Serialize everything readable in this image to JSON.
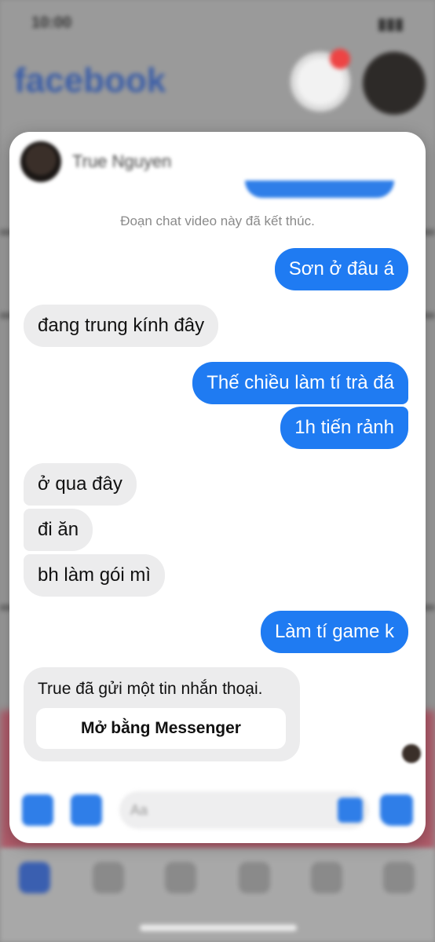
{
  "status_bar": {
    "time": "10:00"
  },
  "background": {
    "app_title": "facebook"
  },
  "chat": {
    "contact_name": "True Nguyen",
    "system_note": "Đoạn chat video này đã kết thúc.",
    "messages": [
      {
        "side": "out",
        "text": "Sơn ở đâu á"
      },
      {
        "side": "in",
        "text": "đang trung kính đây"
      },
      {
        "side": "out",
        "text": "Thế chiều làm tí trà đá"
      },
      {
        "side": "out",
        "text": "1h tiến rảnh"
      },
      {
        "side": "in",
        "text": "ở qua đây"
      },
      {
        "side": "in",
        "text": "đi ăn"
      },
      {
        "side": "in",
        "text": "bh làm gói mì"
      },
      {
        "side": "out",
        "text": "Làm tí game k"
      }
    ],
    "voice_message": {
      "text": "True đã gửi một tin nhắn thoại.",
      "button_label": "Mở bằng Messenger"
    },
    "composer": {
      "placeholder": "Aa"
    }
  },
  "colors": {
    "outgoing_bubble": "#1f7bf2",
    "incoming_bubble": "#ececed"
  }
}
